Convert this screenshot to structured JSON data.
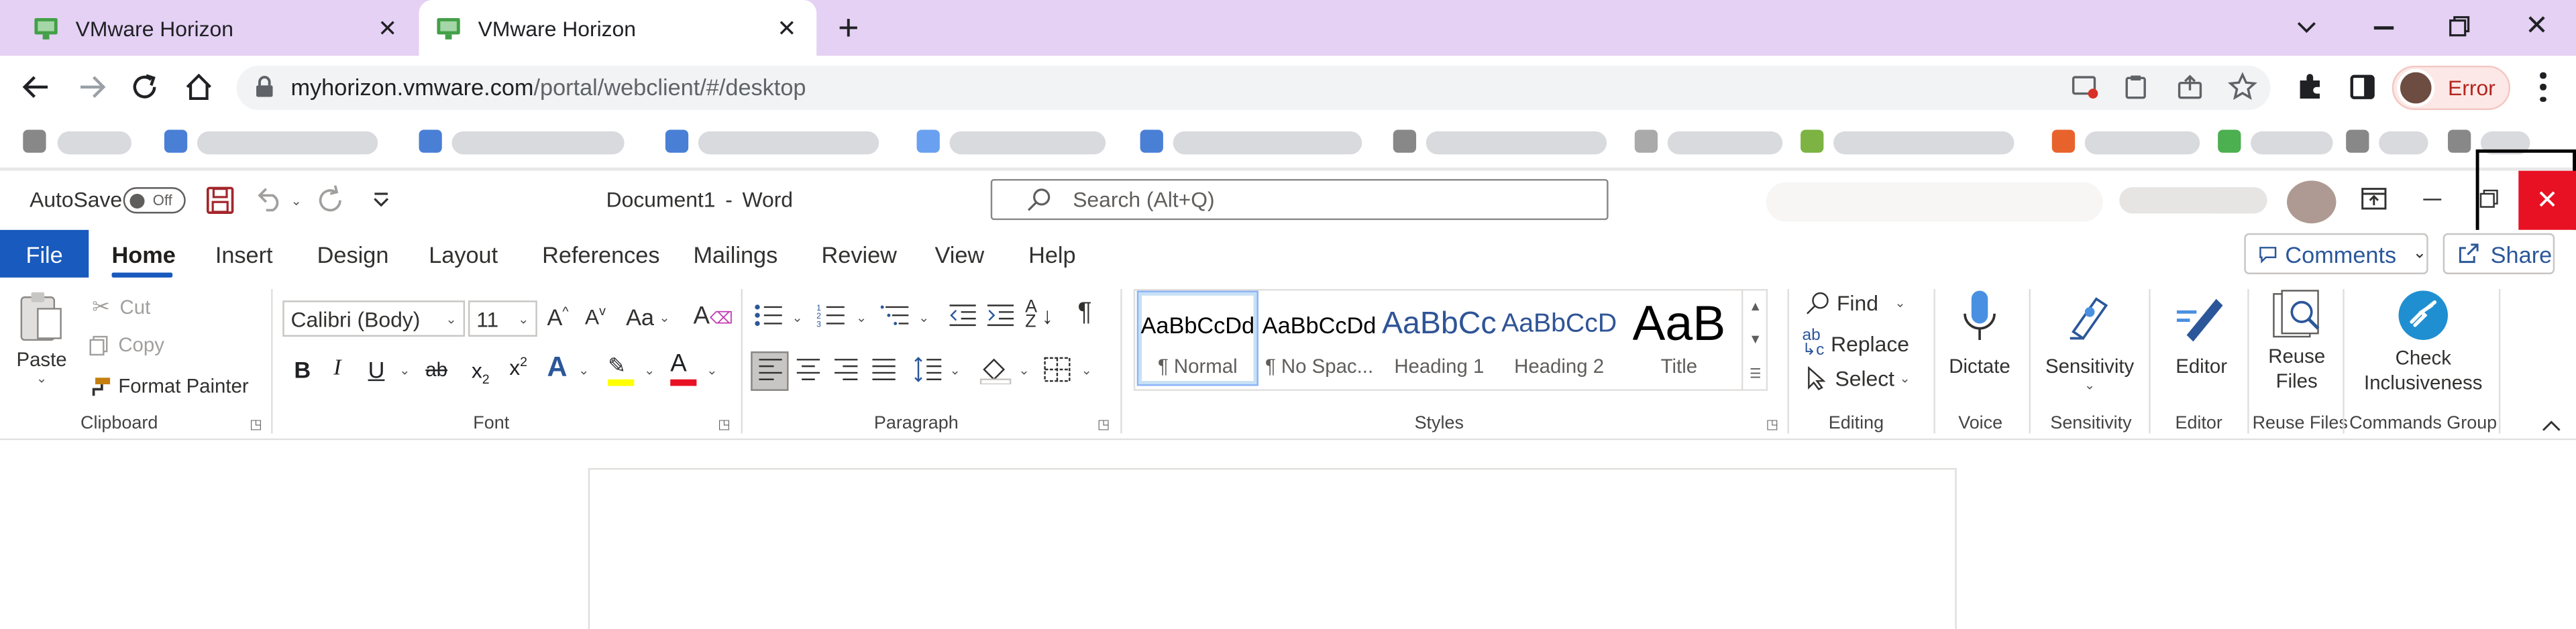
{
  "browser": {
    "tabs": [
      {
        "title": "VMware Horizon",
        "active": false
      },
      {
        "title": "VMware Horizon",
        "active": true
      }
    ],
    "new_tab_glyph": "+",
    "url_host": "myhorizon.vmware.com",
    "url_path": "/portal/webclient/#/desktop",
    "profile_status": "Error",
    "accent_colors": {
      "tab_strip": "#e4d1f4",
      "error_pill": "#fce8e6",
      "error_text": "#b3261e"
    }
  },
  "word": {
    "autosave_label": "AutoSave",
    "autosave_state": "Off",
    "doc_title": "Document1",
    "title_separator": "-",
    "app_name": "Word",
    "search_placeholder": "Search (Alt+Q)",
    "tabs": [
      "File",
      "Home",
      "Insert",
      "Design",
      "Layout",
      "References",
      "Mailings",
      "Review",
      "View",
      "Help"
    ],
    "active_tab": "Home",
    "comments_label": "Comments",
    "share_label": "Share",
    "clipboard": {
      "paste": "Paste",
      "cut": "Cut",
      "copy": "Copy",
      "format_painter": "Format Painter",
      "group": "Clipboard"
    },
    "font": {
      "name": "Calibri (Body)",
      "size": "11",
      "change_case": "Aa",
      "group": "Font"
    },
    "paragraph": {
      "group": "Paragraph"
    },
    "styles": {
      "items": [
        {
          "sample": "AaBbCcDd",
          "name": "¶ Normal"
        },
        {
          "sample": "AaBbCcDd",
          "name": "¶ No Spac..."
        },
        {
          "sample": "AaBbCc",
          "name": "Heading 1"
        },
        {
          "sample": "AaBbCcD",
          "name": "Heading 2"
        },
        {
          "sample": "AaB",
          "name": "Title"
        }
      ],
      "group": "Styles"
    },
    "editing": {
      "find": "Find",
      "replace": "Replace",
      "select": "Select",
      "group": "Editing"
    },
    "voice": {
      "dictate": "Dictate",
      "group": "Voice"
    },
    "sensitivity": {
      "label": "Sensitivity",
      "group": "Sensitivity"
    },
    "editor": {
      "label": "Editor",
      "group": "Editor"
    },
    "reuse": {
      "label_1": "Reuse",
      "label_2": "Files",
      "group": "Reuse Files"
    },
    "inclusiveness": {
      "label_1": "Check",
      "label_2": "Inclusiveness",
      "group": "Commands Group"
    },
    "accent_colors": {
      "word_blue": "#2b579a",
      "file_tab": "#185abd",
      "close_red": "#e81123"
    }
  }
}
